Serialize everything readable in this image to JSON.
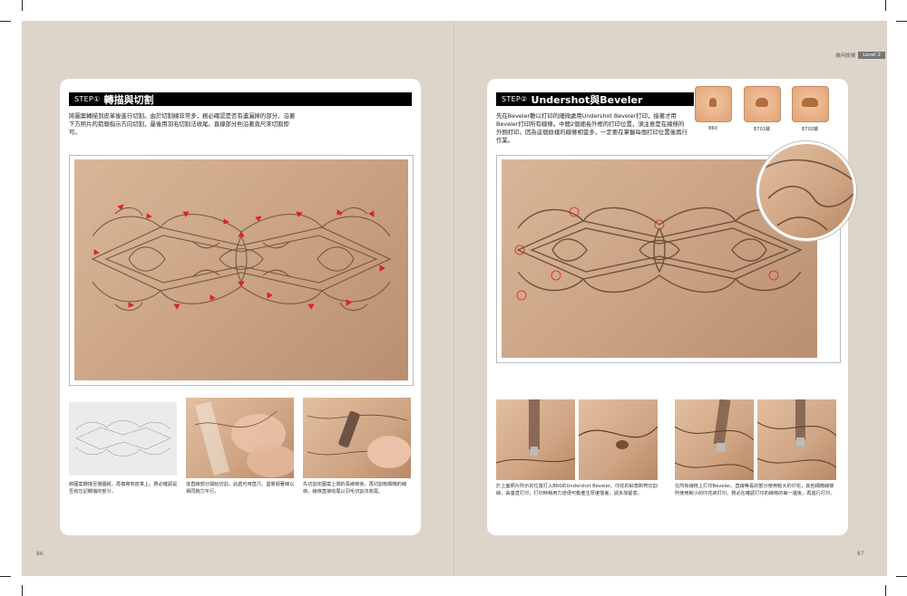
{
  "header": {
    "section": "幾何紋樣",
    "level": "Level 2"
  },
  "left": {
    "step_num": "STEP①",
    "step_title": "轉描與切割",
    "body": "將圖案轉描到皮革後進行切割。由於切割線非常多，務必確認是否有遺漏掉的部分。沿著下方照片的箭頭指示方向切割，最後用羽毛切割法收尾。直線部分則沿著直尺來切割即可。",
    "captions": [
      "將圖案轉描至描圖紙，再複寫到皮革上。務必確認是否有忘記轉描的部分。",
      "從直線部分開始切割，此處可用直尺。盡量順著線以相同腕力平行。",
      "先切割完圖案上側的長線條後，再切割較細微的線條。線條直接收尾以羽毛切割法收尾。"
    ],
    "page_number": "86"
  },
  "right": {
    "step_num": "STEP②",
    "step_title": "Undershot與Beveler",
    "body": "先在Beveler難以打印的細微處用Undershot Beveler打印，接著才用Beveler打印所有線條。中間2個細長外框的打印位置，須注意是在線條的外側打印。因為這個紋樣的線條相當多，一定要在掌握每個打印位置後再行作業。",
    "stamps": [
      "B60",
      "B701腳",
      "B702腳"
    ],
    "captions": [
      "於上面照片所示的位置打入B60的Undershot Beveler。印花的斜角對齊切割線，由垂直打印，打印時稍用力道便可動產生厚度落差，請多加留意。",
      "在所有線條上打印Beveler。直線等長的部分使用較大的印花，其他細微線條則使用較小的印花來打印。務必在確認打印的線條的每一邊後，再進行打印。"
    ],
    "page_number": "87"
  }
}
